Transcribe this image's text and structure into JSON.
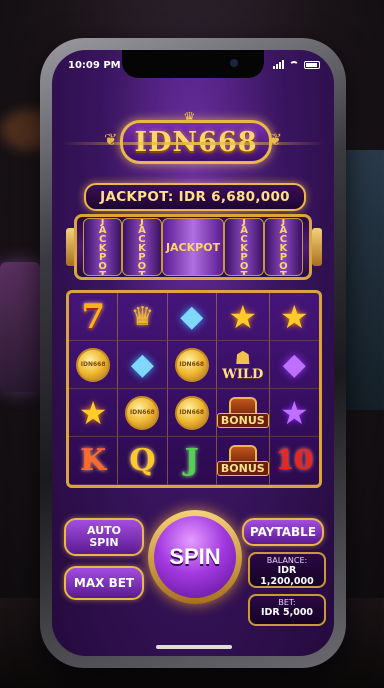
{
  "status_bar": {
    "time": "10:09 PM"
  },
  "header": {
    "logo_text": "IDN668"
  },
  "jackpot": {
    "banner": "JACKPOT: IDR 6,680,000",
    "reels": [
      "JACKPOT",
      "JACKPOT",
      "JACKPOT",
      "JACKPOT",
      "JACKPOT"
    ]
  },
  "reels": {
    "rows": [
      [
        "7",
        "crown",
        "blue-diamond",
        "gold-star",
        "gold-star"
      ],
      [
        "coin",
        "blue-diamond",
        "coin",
        "WILD",
        "purple-diamond"
      ],
      [
        "gold-star",
        "coin",
        "coin",
        "BONUS",
        "purple-star"
      ],
      [
        "K",
        "Q",
        "J",
        "BONUS",
        "10"
      ]
    ],
    "wild_label": "WILD",
    "bonus_label": "BONUS",
    "coin_label": "IDN668",
    "card_k": "K",
    "card_q": "Q",
    "card_j": "J",
    "card_10": "10",
    "seven": "7"
  },
  "controls": {
    "auto_spin_label": "AUTO\nSPIN",
    "max_bet_label": "MAX BET",
    "spin_label": "SPIN",
    "paytable_label": "PAYTABLE",
    "balance_label": "BALANCE:",
    "balance_value": "IDR 1,200,000",
    "bet_label": "BET:",
    "bet_value": "IDR 5,000"
  },
  "colors": {
    "accent_gold": "#e9b84a",
    "purple": "#6a2fa0"
  }
}
